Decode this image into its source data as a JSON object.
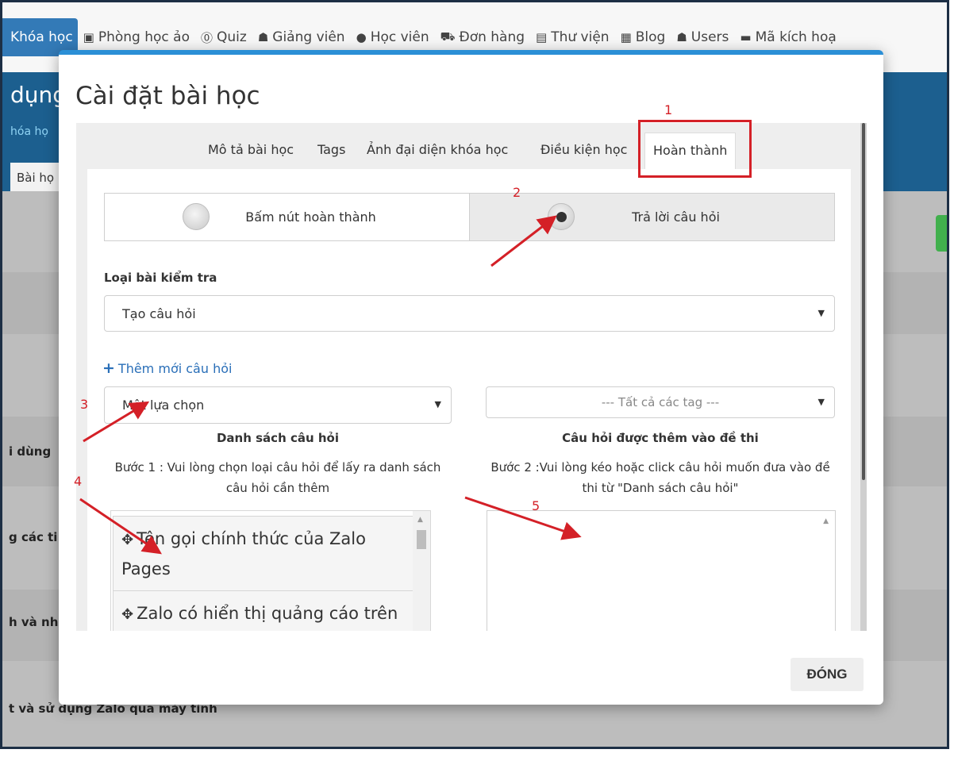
{
  "navbar": {
    "items": [
      {
        "label": "Khóa học",
        "icon": "book-icon",
        "active": true
      },
      {
        "label": "Phòng học ảo",
        "icon": "classroom-icon"
      },
      {
        "label": "Quiz",
        "icon": "question-circle-icon"
      },
      {
        "label": "Giảng viên",
        "icon": "users-icon"
      },
      {
        "label": "Học viên",
        "icon": "user-icon"
      },
      {
        "label": "Đơn hàng",
        "icon": "cart-icon"
      },
      {
        "label": "Thư viện",
        "icon": "library-icon"
      },
      {
        "label": "Blog",
        "icon": "newspaper-icon"
      },
      {
        "label": "Users",
        "icon": "users-icon"
      },
      {
        "label": "Mã kích hoạ",
        "icon": "card-icon"
      }
    ]
  },
  "background": {
    "title": "dụng",
    "subtitle": "hóa họ",
    "tab": "Bài họ",
    "rows": [
      "i dùng",
      "g các ti",
      "h và nh",
      "t và sử dụng Zalo qua máy tính"
    ]
  },
  "modal": {
    "title": "Cài đặt bài học",
    "tabs": [
      "Mô tả bài học",
      "Tags",
      "Ảnh đại diện khóa học",
      "Điều kiện học",
      "Hoàn thành"
    ],
    "completion_options": [
      {
        "label": "Bấm nút hoàn thành",
        "checked": false
      },
      {
        "label": "Trả lời câu hỏi",
        "checked": true
      }
    ],
    "quiz_type_label": "Loại bài kiểm tra",
    "quiz_type_value": "Tạo câu hỏi",
    "add_question_link": "Thêm mới câu hỏi",
    "question_type_value": "Một lựa chọn",
    "tag_filter_value": "--- Tất cả các tag ---",
    "left_column": {
      "title": "Danh sách câu hỏi",
      "help": "Bước 1 : Vui lòng chọn loại câu hỏi để lấy ra danh sách câu hỏi cần thêm",
      "questions": [
        "Tên gọi chính thức của Zalo Pages",
        "Zalo có hiển thị quảng cáo trên"
      ]
    },
    "right_column": {
      "title": "Câu hỏi được thêm vào đề thi",
      "help": "Bước 2 :Vui lòng kéo hoặc click câu hỏi muốn đưa vào đề thi từ \"Danh sách câu hỏi\""
    },
    "close_button": "ĐÓNG"
  },
  "annotations": {
    "numbers": [
      "1",
      "2",
      "3",
      "4",
      "5"
    ],
    "color": "#d42027"
  },
  "colors": {
    "primary": "#337ab7",
    "banner": "#1c5f8f",
    "link": "#2a6fb8",
    "modal_accent": "#2b8fd6"
  }
}
